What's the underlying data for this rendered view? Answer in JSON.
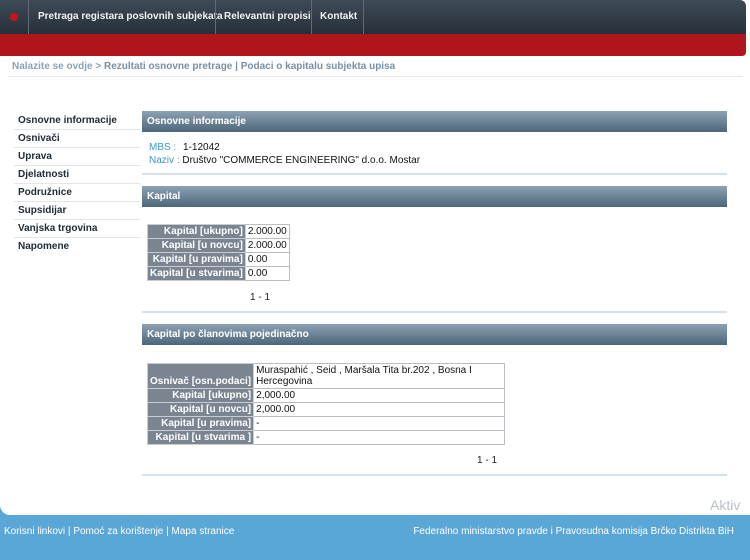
{
  "nav": {
    "items": [
      "Pretraga registara poslovnih subjekata",
      "Relevantni propisi",
      "Kontakt"
    ]
  },
  "breadcrumb": {
    "prefix": "Nalazite se ovdje",
    "arrow": ">",
    "current": "Rezultati osnovne pretrage | Podaci o kapitalu subjekta upisa"
  },
  "sidebar": {
    "items": [
      "Osnovne informacije",
      "Osnivači",
      "Uprava",
      "Djelatnosti",
      "Podružnice",
      "Supsidijar",
      "Vanjska trgovina",
      "Napomene"
    ]
  },
  "basic_info": {
    "title": "Osnovne informacije",
    "mbs_label": "MBS :",
    "mbs_value": "1-12042",
    "naziv_label": "Naziv :",
    "naziv_value": "Društvo \"COMMERCE ENGINEERING\" d.o.o. Mostar"
  },
  "capital": {
    "title": "Kapital",
    "rows": [
      {
        "label": "Kapital [ukupno]",
        "value": "2.000.00"
      },
      {
        "label": "Kapital [u novcu]",
        "value": "2.000.00"
      },
      {
        "label": "Kapital [u pravima]",
        "value": "0.00"
      },
      {
        "label": "Kapital [u stvarima]",
        "value": "0.00"
      }
    ],
    "pager": "1 - 1"
  },
  "members": {
    "title": "Kapital po članovima pojedinačno",
    "rows": [
      {
        "label": "Osnivač [osn.podaci]",
        "value": "Muraspahić , Seid , Maršala Tita br.202 , Bosna I Hercegovina"
      },
      {
        "label": "Kapital [ukupno]",
        "value": "2,000.00"
      },
      {
        "label": "Kapital [u novcu]",
        "value": "2,000.00"
      },
      {
        "label": "Kapital [u pravima]",
        "value": "-"
      },
      {
        "label": "Kapital [u stvarima ]",
        "value": "-"
      }
    ],
    "pager": "1 - 1"
  },
  "watermark": "Aktiv",
  "footer": {
    "links": [
      "Korisni linkovi",
      "Pomoć za korištenje",
      "Mapa stranice"
    ],
    "separator": "|",
    "right": "Federalno ministarstvo pravde i Pravosudna komisija Brčko Distrikta BiH"
  },
  "colors": {
    "nav_bg": "#2f3a45",
    "red_band": "#b0151b",
    "section_header": "#5e7588",
    "page_bg": "#5aa6d6",
    "label_link": "#3b97c9"
  }
}
